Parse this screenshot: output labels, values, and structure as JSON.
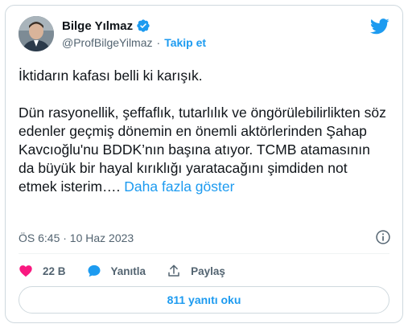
{
  "author": {
    "name": "Bilge Yılmaz",
    "handle": "@ProfBilgeYilmaz",
    "separator": "·",
    "follow_label": "Takip et"
  },
  "tweet": {
    "text": "İktidarın kafası belli ki karışık.\n\nDün rasyonellik, şeffaflık, tutarlılık ve öngörülebilirlikten söz edenler geçmiş dönemin en önemli aktörlerinden Şahap Kavcıoğlu'nu BDDK’nın başına atıyor. TCMB atamasının da büyük bir hayal kırıklığı yaratacağını şimdiden not etmek isterim…. ",
    "show_more_label": "Daha fazla göster",
    "timestamp": "ÖS 6:45 · 10 Haz 2023"
  },
  "actions": {
    "likes": "22 B",
    "reply_label": "Yanıtla",
    "share_label": "Paylaş"
  },
  "replies_button_label": "811 yanıtı oku",
  "icons": {
    "verified": "verified-badge-icon",
    "twitter": "twitter-bird-icon",
    "info": "info-icon",
    "like": "heart-icon",
    "reply": "speech-bubble-icon",
    "share": "share-upload-icon"
  },
  "colors": {
    "accent": "#1d9bf0",
    "like": "#f91880",
    "text": "#0f1419",
    "muted": "#536471"
  }
}
